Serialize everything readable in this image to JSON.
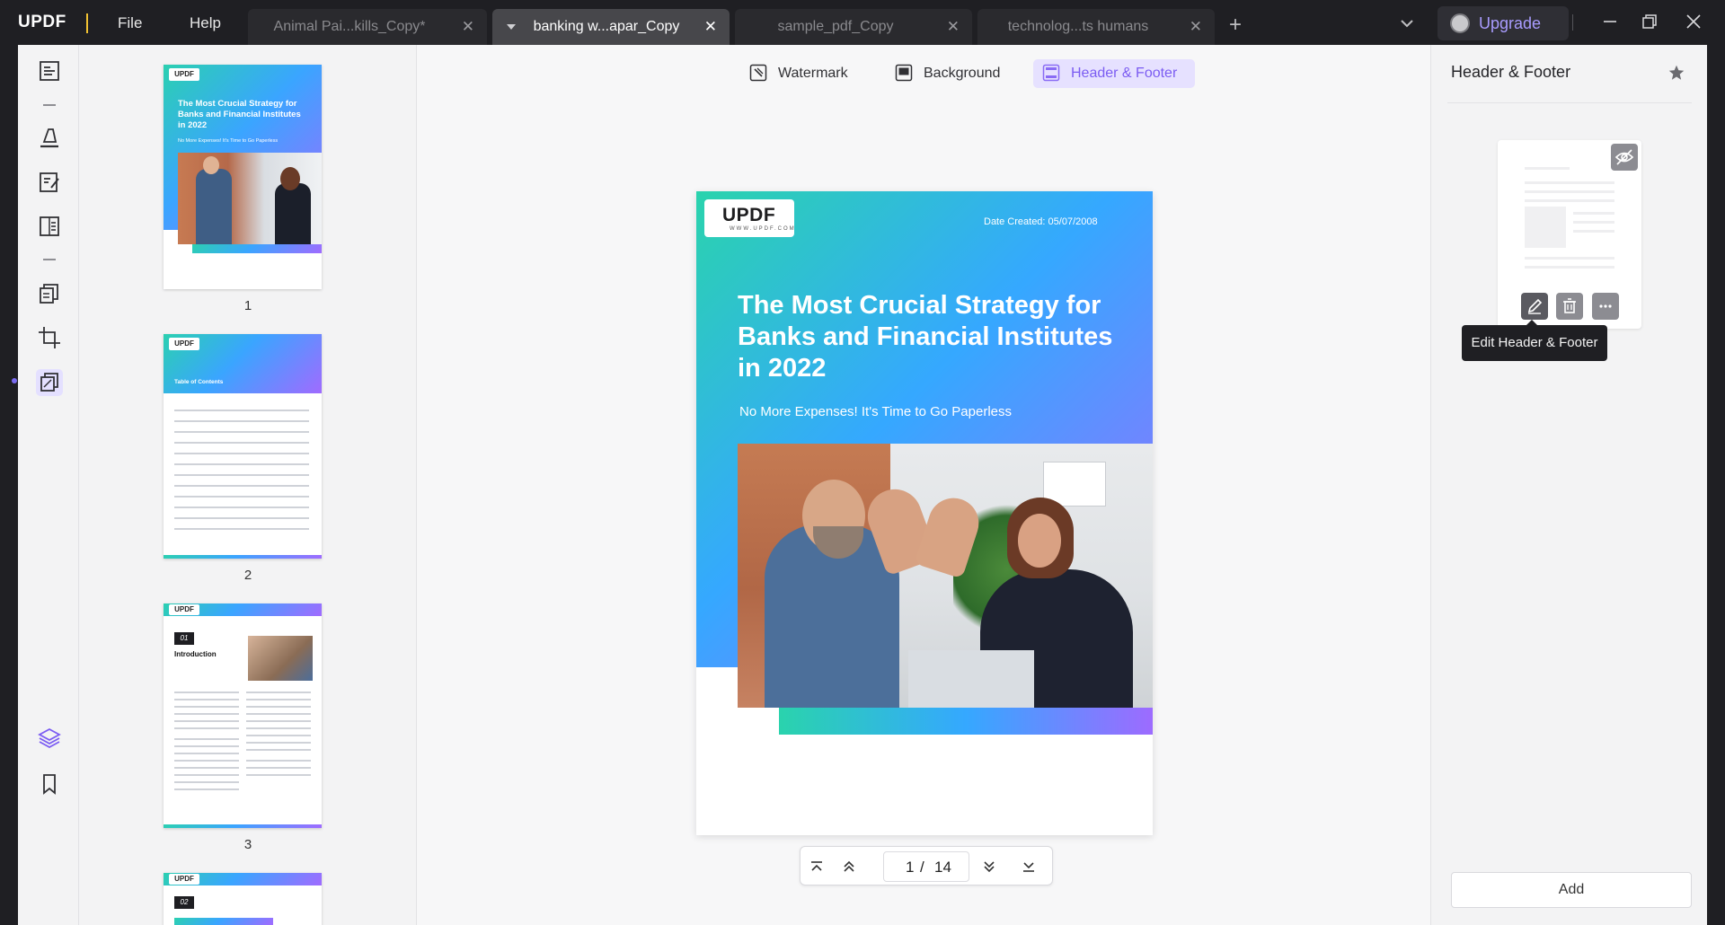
{
  "app": {
    "logo": "UPDF",
    "menu": {
      "file": "File",
      "help": "Help"
    }
  },
  "tabs": [
    {
      "label": "Animal Pai...kills_Copy*",
      "active": false
    },
    {
      "label": "banking w...apar_Copy",
      "active": true
    },
    {
      "label": "sample_pdf_Copy",
      "active": false
    },
    {
      "label": "technolog...ts humans",
      "active": false
    }
  ],
  "titlebar": {
    "upgrade_label": "Upgrade"
  },
  "toolbar": {
    "watermark": "Watermark",
    "background": "Background",
    "header_footer": "Header & Footer"
  },
  "thumbnails": {
    "page_numbers": [
      "1",
      "2",
      "3"
    ],
    "page1_title": "The Most Crucial Strategy for Banks and Financial Institutes in 2022",
    "page1_sub": "No More Expenses! It's Time to Go Paperless",
    "page2_heading": "Table of Contents",
    "page3_badge": "01",
    "page3_heading": "Introduction",
    "page4_badge": "02"
  },
  "document": {
    "logo_text": "UPDF",
    "logo_sub": "WWW.UPDF.COM",
    "date_created": "Date Created: 05/07/2008",
    "title": "The Most Crucial Strategy for Banks and Financial Institutes in 2022",
    "subtitle": "No More Expenses! It's Time to Go Paperless"
  },
  "pager": {
    "current": "1",
    "separator": "/",
    "total": "14"
  },
  "right_panel": {
    "title": "Header & Footer",
    "tooltip": "Edit Header & Footer",
    "add_label": "Add"
  },
  "colors": {
    "accent": "#7b5cf2",
    "gradient_start": "#2ad3ad",
    "gradient_mid": "#35a8ff",
    "gradient_end": "#9d6bff"
  }
}
